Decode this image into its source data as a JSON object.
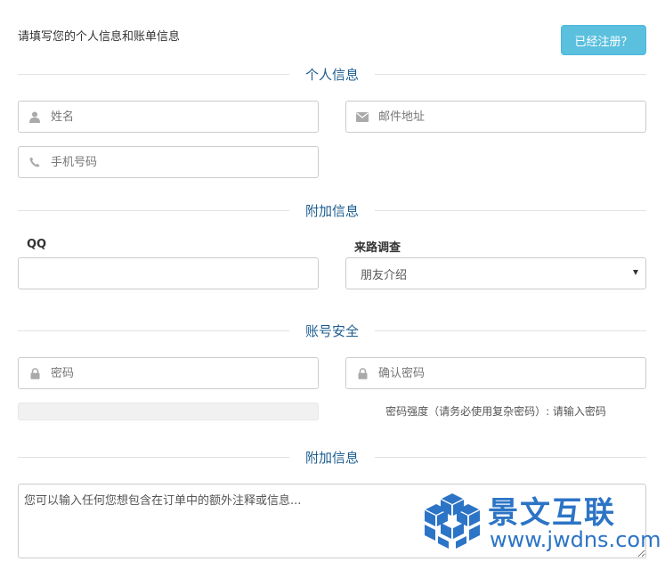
{
  "header": {
    "intro": "请填写您的个人信息和账单信息",
    "login_button": "已经注册？"
  },
  "sections": {
    "personal": "个人信息",
    "extra": "附加信息",
    "security": "账号安全",
    "extra2": "附加信息"
  },
  "personal": {
    "name_placeholder": "姓名",
    "email_placeholder": "邮件地址",
    "phone_placeholder": "手机号码"
  },
  "extra": {
    "qq_label": "QQ",
    "qq_value": "",
    "source_label": "来路调查",
    "source_selected": "朋友介绍"
  },
  "security": {
    "password_placeholder": "密码",
    "confirm_placeholder": "确认密码",
    "strength_progress": 0,
    "strength_hint": "密码强度（请务必使用复杂密码）: 请输入密码"
  },
  "notes": {
    "placeholder": "您可以输入任何您想包含在订单中的额外注释或信息..."
  },
  "watermark": {
    "title": "景文互联",
    "url": "www.jwdns.com"
  },
  "colors": {
    "accent": "#5bc0de",
    "section_title": "#1d5d8f",
    "logo": "#2c74c6"
  }
}
